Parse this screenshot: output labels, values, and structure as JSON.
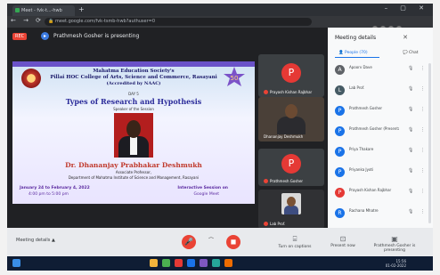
{
  "browser": {
    "tab_title": "Meet - fvk-t...-hwb",
    "url": "meet.google.com/fvk-tsmb-hwb?authuser=0",
    "window_controls": "– ▢ ✕"
  },
  "meet": {
    "rec_label": "REC",
    "presenting_text": "Prathmesh Gosher is presenting"
  },
  "slide": {
    "line1": "Mahatma Education Society's",
    "line2": "Pillai HOC College of Arts, Science and Commerce, Rasayani",
    "line3": "(Accredited by NAAC)",
    "day": "DAY 5",
    "title": "Types of Research and Hypothesis",
    "resource": "Speaker of the Session",
    "speaker_name": "Dr. Dhananjay Prabhakar Deshmukh",
    "designation": "Associate Professor,",
    "institute": "Department of Mahatma Institute of Science and Management, Rasayani",
    "date": "January 24 to February 4, 2022",
    "time": "4:00 pm to 5:00 pm",
    "mode": "Interactive Session on",
    "platform": "Google Meet",
    "logo_number": "50"
  },
  "tiles": [
    {
      "initial": "P",
      "name": "Prayash Kishan Rajbhar"
    },
    {
      "name": "Dhananjay Deshmukh"
    },
    {
      "initial": "P",
      "name": "Prathmesh Gosher"
    },
    {
      "name": "Lab Prof."
    }
  ],
  "panel": {
    "title": "Meeting details",
    "tab_people": "People (70)",
    "tab_chat": "Chat",
    "people": [
      {
        "initial": "A",
        "name": "Apoorv Dave",
        "color": "#5f6368"
      },
      {
        "initial": "L",
        "name": "Lab Prof.",
        "color": "#455a64"
      },
      {
        "initial": "P",
        "name": "Prathmesh Gosher",
        "color": "#1a73e8"
      },
      {
        "initial": "P",
        "name": "Prathmesh Gosher (Presentation)",
        "color": "#1a73e8"
      },
      {
        "initial": "P",
        "name": "Priya Thakare",
        "color": "#1a73e8"
      },
      {
        "initial": "P",
        "name": "Priyanka Jyoti",
        "color": "#1a73e8"
      },
      {
        "initial": "P",
        "name": "Prayash Kishan Rajbhar",
        "color": "#e53935"
      },
      {
        "initial": "R",
        "name": "Rachana Mhatre",
        "color": "#1a73e8"
      }
    ]
  },
  "controls": {
    "meeting_details": "Meeting details",
    "captions": "Turn on captions",
    "present": "Present now",
    "raise": "Prathmesh Gosher is presenting"
  },
  "taskbar": {
    "time": "15:56",
    "date": "01-02-2022"
  }
}
